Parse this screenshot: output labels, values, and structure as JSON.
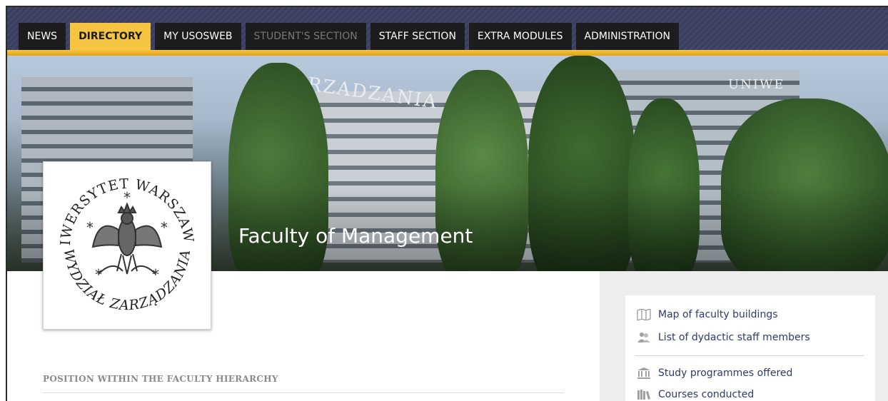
{
  "nav": {
    "tabs": [
      {
        "label": "NEWS",
        "state": "normal"
      },
      {
        "label": "DIRECTORY",
        "state": "active"
      },
      {
        "label": "MY USOSWEB",
        "state": "normal"
      },
      {
        "label": "STUDENT'S SECTION",
        "state": "disabled"
      },
      {
        "label": "STAFF SECTION",
        "state": "normal"
      },
      {
        "label": "EXTRA MODULES",
        "state": "normal"
      },
      {
        "label": "ADMINISTRATION",
        "state": "normal"
      }
    ],
    "accent_color": "#f5c542",
    "bar_color": "#3a3d5c"
  },
  "banner": {
    "title": "Faculty of Management",
    "building_signs": [
      "RZADZANIA",
      "UNIWE"
    ]
  },
  "logo": {
    "outer_text_top": "UNIWERSYTET WARSZAWSKI",
    "outer_text_bottom": "WYDZIAŁ ZARZĄDZANIA"
  },
  "side_links": [
    {
      "label": "Map of faculty buildings",
      "icon": "map-icon"
    },
    {
      "label": "List of dydactic staff members",
      "icon": "people-icon"
    },
    {
      "label": "Study programmes offered",
      "icon": "building-icon"
    },
    {
      "label": "Courses conducted",
      "icon": "books-icon"
    }
  ],
  "sections": {
    "hierarchy_heading": "POSITION WITHIN THE FACULTY HIERARCHY"
  }
}
